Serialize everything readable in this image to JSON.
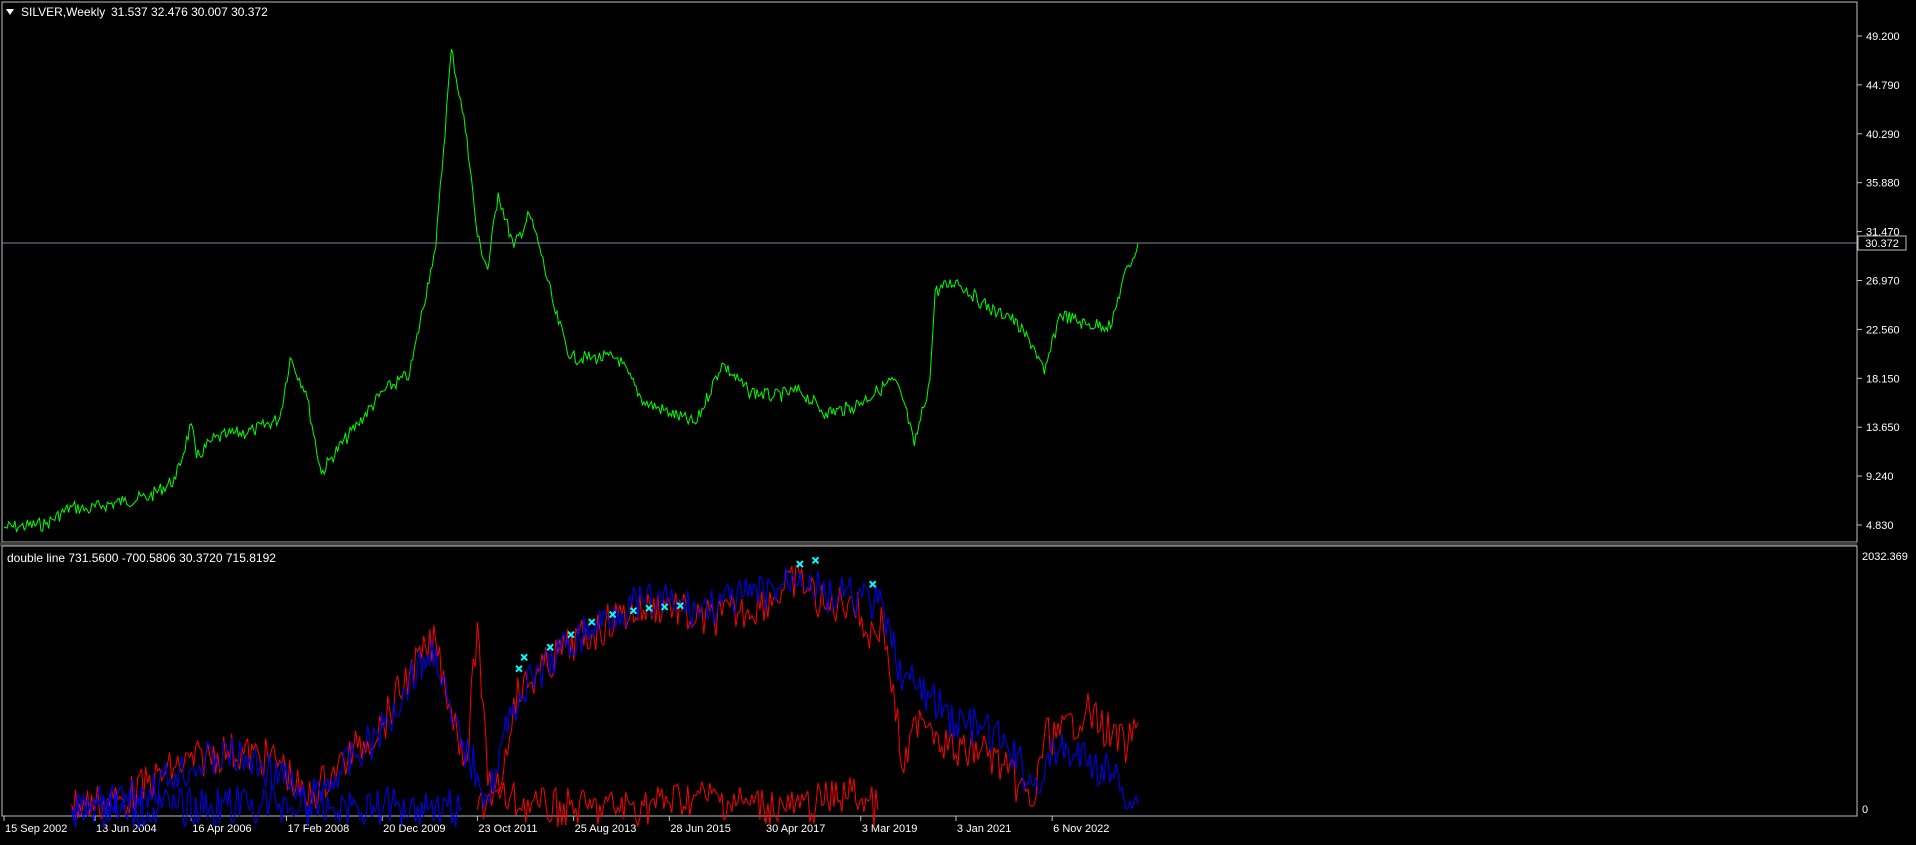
{
  "main_panel": {
    "symbol_label": "SILVER,Weekly",
    "ohlc_text": "31.537 32.476 30.007 30.372",
    "menu_icon": "triangle-down-icon",
    "current_price": "30.372"
  },
  "sub_panel": {
    "indicator_label": "double line 731.5600 -700.5806 30.3720 715.8192",
    "top_scale": "2032.369",
    "bottom_scale": "0"
  },
  "colors": {
    "background": "#000000",
    "frame": "#c0c0c0",
    "price_line": "#00ff00",
    "indicator_red": "#ff0000",
    "indicator_blue": "#0000ff",
    "marker": "#00ffff",
    "current_price_line": "#7a8ca0",
    "axis_text": "#ffffff"
  },
  "chart_data": [
    {
      "type": "line",
      "title": "SILVER,Weekly",
      "y_ticks": [
        "49.200",
        "44.790",
        "40.290",
        "35.880",
        "31.470",
        "26.970",
        "22.560",
        "18.150",
        "13.650",
        "9.240",
        "4.830"
      ],
      "ylim": [
        4.83,
        49.2
      ],
      "x_ticks": [
        "15 Sep 2002",
        "13 Jun 2004",
        "16 Apr 2006",
        "17 Feb 2008",
        "20 Dec 2009",
        "23 Oct 2011",
        "25 Aug 2013",
        "28 Jun 2015",
        "30 Apr 2017",
        "3 Mar 2019",
        "3 Jan 2021",
        "6 Nov 2022"
      ],
      "series": [
        {
          "name": "SILVER",
          "color": "#00ff00",
          "x": [
            2002.7,
            2003.0,
            2003.5,
            2004.0,
            2004.3,
            2004.6,
            2005.0,
            2005.5,
            2006.0,
            2006.3,
            2006.4,
            2006.7,
            2007.0,
            2007.5,
            2008.0,
            2008.2,
            2008.5,
            2008.8,
            2009.0,
            2009.5,
            2010.0,
            2010.5,
            2010.9,
            2011.0,
            2011.3,
            2011.6,
            2011.8,
            2012.0,
            2012.2,
            2012.5,
            2012.8,
            2013.0,
            2013.3,
            2013.6,
            2014.0,
            2014.5,
            2015.0,
            2015.5,
            2016.0,
            2016.5,
            2017.0,
            2017.5,
            2018.0,
            2018.5,
            2019.0,
            2019.5,
            2019.8,
            2020.0,
            2020.2,
            2020.5,
            2020.6,
            2021.0,
            2021.5,
            2021.8,
            2022.0,
            2022.5,
            2022.7,
            2023.0,
            2023.5,
            2024.0,
            2024.2,
            2024.4,
            2024.5
          ],
          "y": [
            4.6,
            4.7,
            4.9,
            6.5,
            6.2,
            6.6,
            7.0,
            7.4,
            9.0,
            14.0,
            10.9,
            12.5,
            13.0,
            13.4,
            14.5,
            20.0,
            17.0,
            9.5,
            11.0,
            14.0,
            17.0,
            18.5,
            28.0,
            30.0,
            48.0,
            40.0,
            31.0,
            28.0,
            35.0,
            30.0,
            33.0,
            30.0,
            24.0,
            20.0,
            20.0,
            20.0,
            16.0,
            15.0,
            14.0,
            19.5,
            17.0,
            16.5,
            17.0,
            15.0,
            15.5,
            17.0,
            18.0,
            16.0,
            12.0,
            18.0,
            26.0,
            27.0,
            25.0,
            24.0,
            24.0,
            21.0,
            18.5,
            24.0,
            23.0,
            23.0,
            27.0,
            29.0,
            30.4
          ]
        }
      ]
    },
    {
      "type": "line",
      "title": "double line 731.5600 -700.5806 30.3720 715.8192",
      "ylim": [
        0,
        2032.369
      ],
      "y_ticks": [
        "2032.369",
        "0"
      ],
      "series": [
        {
          "name": "red-upper",
          "color": "#ff0000",
          "x": [
            2004.0,
            2005.0,
            2006.0,
            2007.0,
            2008.0,
            2008.5,
            2009.0,
            2009.5,
            2010.0,
            2010.5,
            2011.0,
            2011.3,
            2011.6,
            2011.8,
            2012.0,
            2012.3,
            2012.5,
            2013.0,
            2013.5,
            2014.0,
            2014.5,
            2015.0,
            2015.5,
            2016.0,
            2016.5,
            2017.0,
            2017.5,
            2018.0,
            2018.5,
            2019.0,
            2019.3,
            2019.6,
            2020.0,
            2020.3,
            2020.5,
            2021.0,
            2021.5,
            2022.0,
            2022.5,
            2022.7,
            2023.0,
            2023.5,
            2024.0,
            2024.3,
            2024.5
          ],
          "y": [
            50,
            90,
            350,
            480,
            400,
            80,
            300,
            500,
            700,
            1100,
            1350,
            800,
            400,
            1500,
            200,
            300,
            900,
            1100,
            1300,
            1400,
            1550,
            1600,
            1650,
            1500,
            1550,
            1600,
            1700,
            1850,
            1600,
            1700,
            1400,
            1500,
            300,
            800,
            700,
            450,
            500,
            300,
            50,
            600,
            600,
            800,
            600,
            500,
            700
          ]
        },
        {
          "name": "red-lower",
          "color": "#ff0000",
          "x": [
            2011.8,
            2012.0,
            2013.0,
            2014.0,
            2015.0,
            2016.0,
            2017.0,
            2018.0,
            2019.0,
            2019.5
          ],
          "y": [
            10,
            120,
            30,
            20,
            40,
            120,
            60,
            20,
            150,
            10
          ]
        },
        {
          "name": "blue-upper",
          "color": "#0000ff",
          "x": [
            2004.0,
            2005.0,
            2006.0,
            2007.0,
            2008.0,
            2008.5,
            2009.0,
            2009.5,
            2010.0,
            2010.5,
            2011.0,
            2011.3,
            2011.8,
            2012.0,
            2012.5,
            2013.0,
            2013.5,
            2014.0,
            2014.5,
            2015.0,
            2015.5,
            2016.0,
            2016.5,
            2017.0,
            2017.5,
            2018.0,
            2018.5,
            2019.0,
            2019.5,
            2020.0,
            2020.5,
            2021.0,
            2021.5,
            2022.0,
            2022.5,
            2023.0,
            2023.5,
            2024.0,
            2024.5
          ],
          "y": [
            20,
            60,
            300,
            450,
            300,
            50,
            250,
            450,
            650,
            1050,
            1300,
            700,
            300,
            100,
            850,
            1100,
            1300,
            1450,
            1600,
            1650,
            1650,
            1600,
            1650,
            1700,
            1750,
            1900,
            1700,
            1700,
            1650,
            1050,
            900,
            700,
            650,
            500,
            200,
            500,
            400,
            300,
            50
          ]
        },
        {
          "name": "blue-lower",
          "color": "#0000ff",
          "x": [
            2004.0,
            2005.0,
            2006.0,
            2007.0,
            2008.0,
            2009.0,
            2010.0,
            2011.0,
            2011.5
          ],
          "y": [
            10,
            20,
            30,
            40,
            60,
            30,
            40,
            50,
            20
          ]
        },
        {
          "name": "markers",
          "color": "#00ffff",
          "x": [
            2012.6,
            2012.7,
            2013.2,
            2013.6,
            2014.0,
            2014.4,
            2014.8,
            2015.1,
            2015.4,
            2015.7,
            2018.0,
            2018.3,
            2019.4
          ],
          "y": [
            1130,
            1220,
            1300,
            1400,
            1500,
            1560,
            1590,
            1610,
            1620,
            1630,
            1960,
            1990,
            1800
          ]
        }
      ]
    }
  ]
}
